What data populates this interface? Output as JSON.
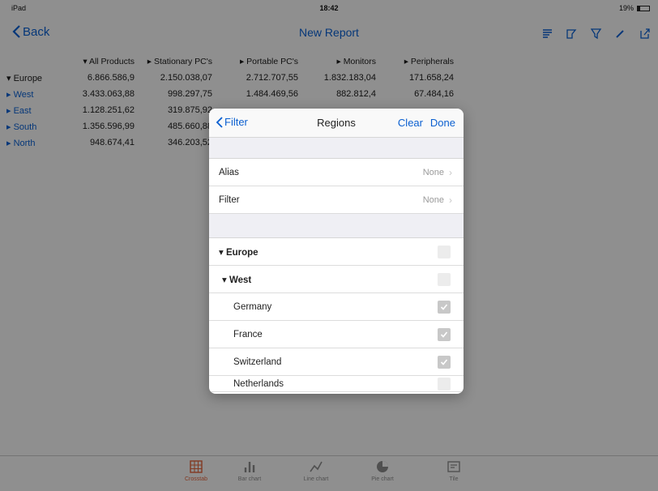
{
  "status": {
    "carrier": "iPad",
    "time": "18:42",
    "battery": "19%"
  },
  "nav": {
    "back_label": "Back",
    "title": "New Report"
  },
  "table": {
    "headers": [
      "▾ All Products",
      "▸ Stationary PC's",
      "▸ Portable PC's",
      "▸ Monitors",
      "▸ Peripherals"
    ],
    "rows": [
      {
        "label": "▾ Europe",
        "values": [
          "6.866.586,9",
          "2.150.038,07",
          "2.712.707,55",
          "1.832.183,04",
          "171.658,24"
        ]
      },
      {
        "label": "▸ West",
        "values": [
          "3.433.063,88",
          "998.297,75",
          "1.484.469,56",
          "882.812,4",
          "67.484,16"
        ]
      },
      {
        "label": "▸ East",
        "values": [
          "1.128.251,62",
          "319.875,92",
          "",
          "",
          ""
        ]
      },
      {
        "label": "▸ South",
        "values": [
          "1.356.596,99",
          "485.660,88",
          "",
          "",
          ""
        ]
      },
      {
        "label": "▸ North",
        "values": [
          "948.674,41",
          "346.203,52",
          "",
          "",
          ""
        ]
      }
    ]
  },
  "tabs": [
    {
      "label": "Crosstab",
      "icon": "grid-icon"
    },
    {
      "label": "Bar chart",
      "icon": "bar-chart-icon"
    },
    {
      "label": "Line chart",
      "icon": "line-chart-icon"
    },
    {
      "label": "Pie chart",
      "icon": "pie-chart-icon"
    },
    {
      "label": "Tile",
      "icon": "tile-icon"
    }
  ],
  "popover": {
    "back_label": "Filter",
    "title": "Regions",
    "clear_label": "Clear",
    "done_label": "Done",
    "alias": {
      "label": "Alias",
      "value": "None"
    },
    "filter": {
      "label": "Filter",
      "value": "None"
    },
    "tree": [
      {
        "label": "▾ Europe",
        "checked": false
      },
      {
        "label": "▾ West",
        "checked": false
      },
      {
        "label": "Germany",
        "checked": true
      },
      {
        "label": "France",
        "checked": true
      },
      {
        "label": "Switzerland",
        "checked": true
      },
      {
        "label": "Netherlands",
        "checked": false
      }
    ]
  },
  "colors": {
    "accent": "#0a5fd0",
    "active_tab": "#e0623a"
  }
}
